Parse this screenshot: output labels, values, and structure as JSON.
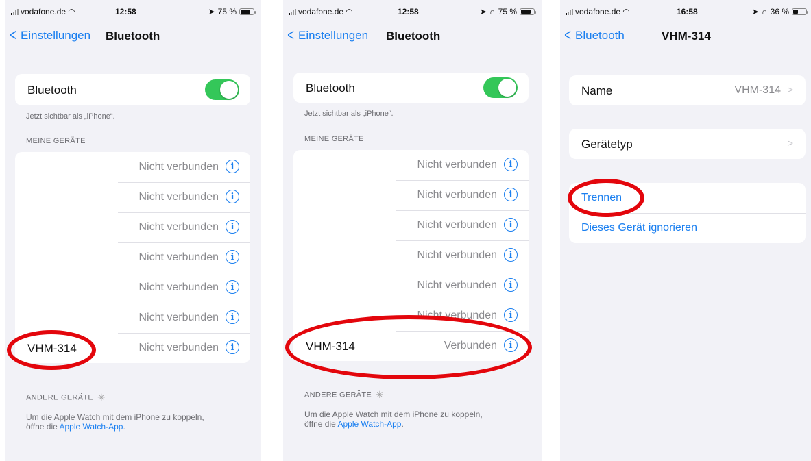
{
  "colors": {
    "accent": "#1a7ff0",
    "toggle_on": "#34c759",
    "highlight_ring": "#e3060c"
  },
  "screen1": {
    "status": {
      "carrier": "vodafone.de",
      "time": "12:58",
      "battery": "75 %",
      "battery_level": 0.75
    },
    "nav": {
      "back": "Einstellungen",
      "title": "Bluetooth"
    },
    "bluetooth_label": "Bluetooth",
    "visible_text": "Jetzt sichtbar als „iPhone“.",
    "my_devices_header": "MEINE GERÄTE",
    "devices": [
      {
        "name": "",
        "status": "Nicht verbunden"
      },
      {
        "name": "",
        "status": "Nicht verbunden"
      },
      {
        "name": "",
        "status": "Nicht verbunden"
      },
      {
        "name": "",
        "status": "Nicht verbunden"
      },
      {
        "name": "",
        "status": "Nicht verbunden"
      },
      {
        "name": "",
        "status": "Nicht verbunden"
      },
      {
        "name": "VHM-314",
        "status": "Nicht verbunden"
      }
    ],
    "other_devices_header": "ANDERE GERÄTE",
    "footer_text": "Um die Apple Watch mit dem iPhone zu koppeln,",
    "footer_text2": "öffne die",
    "footer_link": "Apple Watch-App",
    "footer_end": "."
  },
  "screen2": {
    "status": {
      "carrier": "vodafone.de",
      "time": "12:58",
      "battery": "75 %",
      "battery_level": 0.75
    },
    "nav": {
      "back": "Einstellungen",
      "title": "Bluetooth"
    },
    "bluetooth_label": "Bluetooth",
    "visible_text": "Jetzt sichtbar als „iPhone“.",
    "my_devices_header": "MEINE GERÄTE",
    "devices": [
      {
        "name": "",
        "status": "Nicht verbunden"
      },
      {
        "name": "",
        "status": "Nicht verbunden"
      },
      {
        "name": "",
        "status": "Nicht verbunden"
      },
      {
        "name": "",
        "status": "Nicht verbunden"
      },
      {
        "name": "",
        "status": "Nicht verbunden"
      },
      {
        "name": "",
        "status": "Nicht verbunden"
      },
      {
        "name": "VHM-314",
        "status": "Verbunden"
      }
    ],
    "other_devices_header": "ANDERE GERÄTE",
    "footer_text": "Um die Apple Watch mit dem iPhone zu koppeln,",
    "footer_text2": "öffne die",
    "footer_link": "Apple Watch-App",
    "footer_end": "."
  },
  "screen3": {
    "status": {
      "carrier": "vodafone.de",
      "time": "16:58",
      "battery": "36 %",
      "battery_level": 0.36
    },
    "nav": {
      "back": "Bluetooth",
      "title": "VHM-314"
    },
    "name_label": "Name",
    "name_value": "VHM-314",
    "device_type_label": "Gerätetyp",
    "disconnect": "Trennen",
    "forget": "Dieses Gerät ignorieren"
  }
}
